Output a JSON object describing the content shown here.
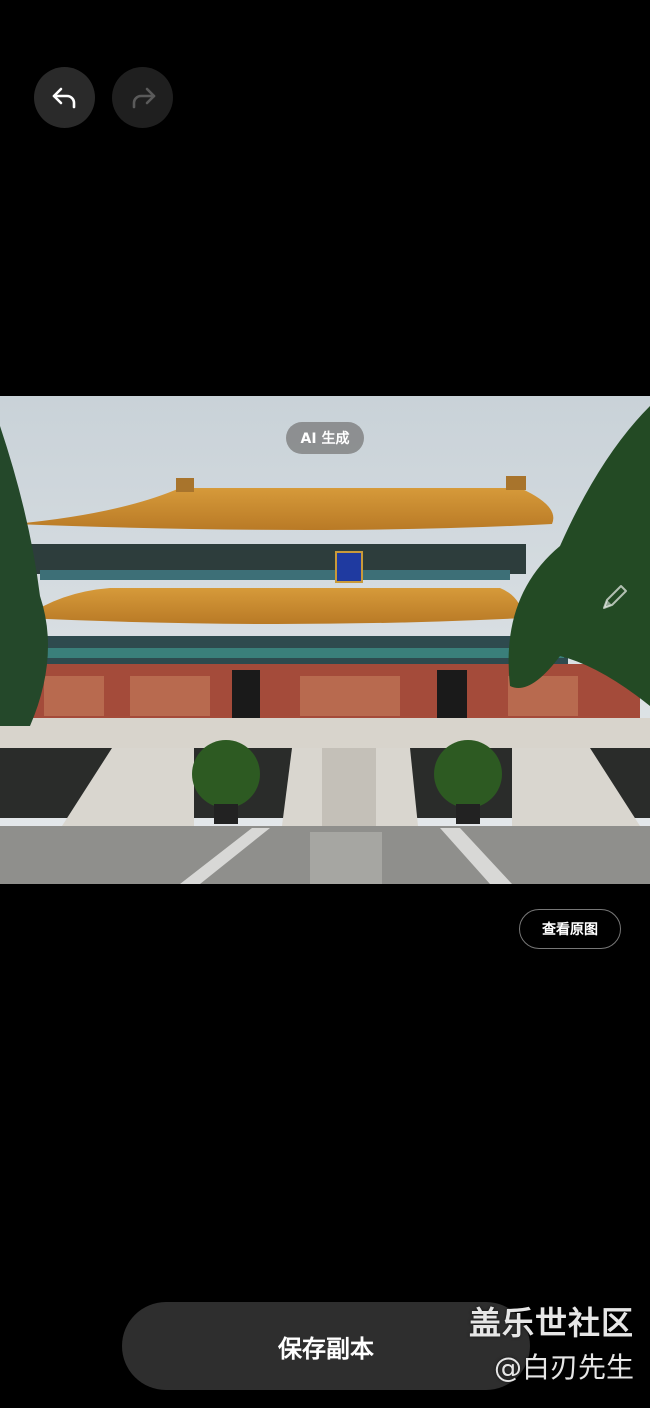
{
  "toolbar": {
    "undo_icon": "undo-arrow-icon",
    "redo_icon": "redo-arrow-icon"
  },
  "photo": {
    "badge_label": "AI 生成",
    "edit_icon": "pencil-icon"
  },
  "actions": {
    "view_original_label": "查看原图",
    "save_copy_label": "保存副本"
  },
  "watermark": {
    "title": "盖乐世社区",
    "author": "@白刃先生"
  },
  "colors": {
    "background": "#000000",
    "button_bg": "#2a2a2a",
    "save_bar_bg": "#2e2e2e",
    "text": "#ffffff"
  }
}
